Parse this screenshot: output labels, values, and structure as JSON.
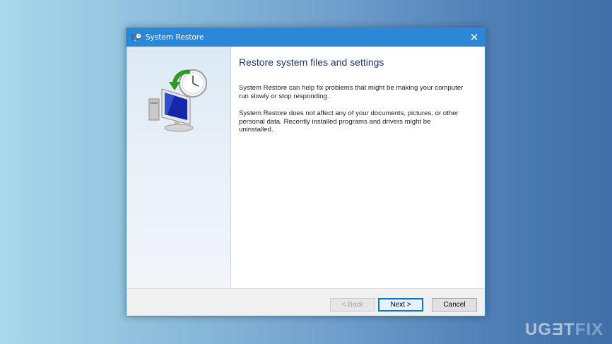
{
  "window": {
    "title": "System Restore",
    "close_glyph": "✕",
    "icon": "system-restore-icon"
  },
  "sidebar": {
    "icon": "system-restore-computer-clock-icon"
  },
  "main": {
    "heading": "Restore system files and settings",
    "paragraph1": "System Restore can help fix problems that might be making your computer run slowly or stop responding.",
    "paragraph2": "System Restore does not affect any of your documents, pictures, or other personal data. Recently installed programs and drivers might be uninstalled."
  },
  "footer": {
    "back_label": "< Back",
    "next_label": "Next >",
    "cancel_label": "Cancel",
    "back_enabled": false
  },
  "watermark": {
    "prefix": "UG",
    "e_glyph": "Ǝ",
    "t": "T",
    "fix": "FIX"
  },
  "colors": {
    "titlebar": "#2b88d8",
    "heading": "#1e3a6e",
    "focus_border": "#0078d7"
  }
}
